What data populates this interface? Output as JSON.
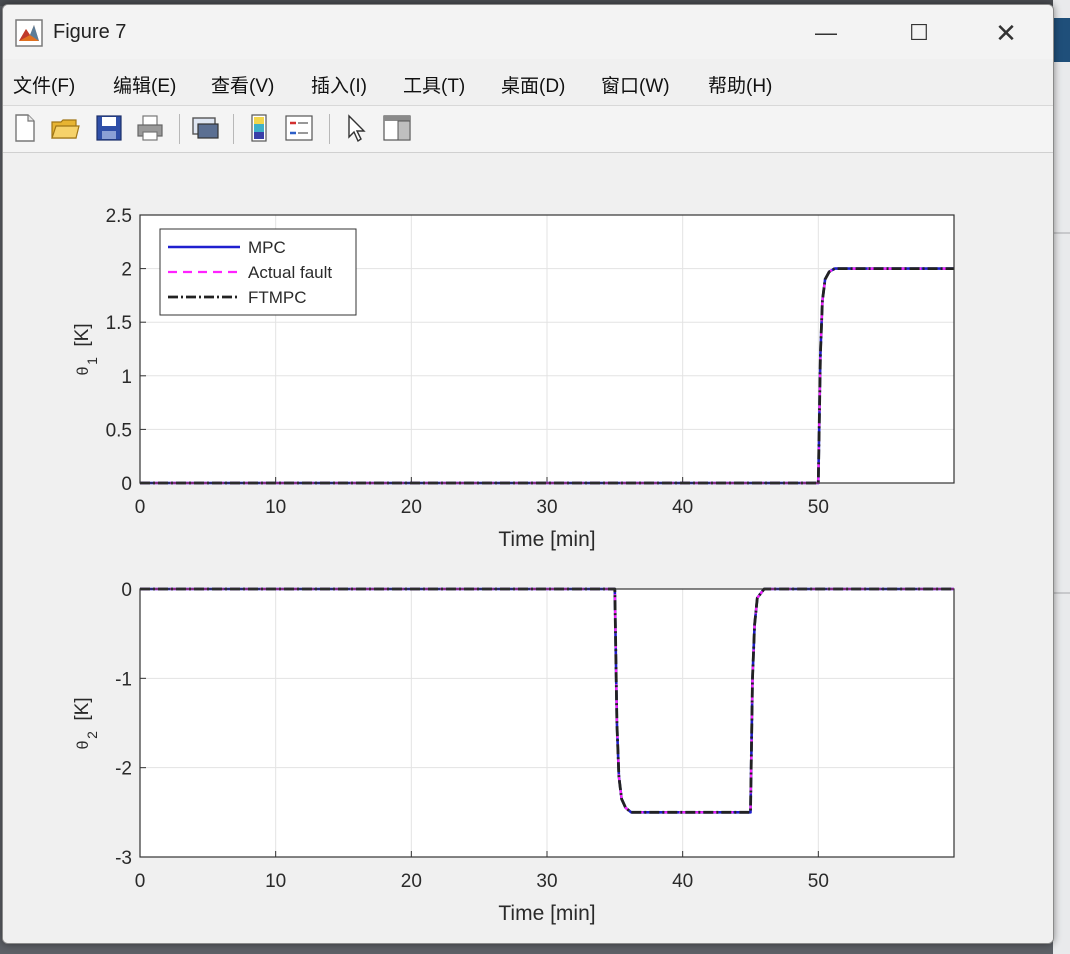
{
  "window": {
    "title": "Figure 7",
    "controls": {
      "minimize": "—",
      "maximize": "☐",
      "close": "✕"
    }
  },
  "menu": [
    "文件(F)",
    "编辑(E)",
    "查看(V)",
    "插入(I)",
    "工具(T)",
    "桌面(D)",
    "窗口(W)",
    "帮助(H)"
  ],
  "toolbar": {
    "buttons": [
      "new-figure-icon",
      "open-file-icon",
      "save-icon",
      "print-icon",
      "link-plot-icon",
      "insert-colorbar-icon",
      "insert-legend-icon",
      "edit-plot-pointer-icon",
      "property-inspector-icon"
    ]
  },
  "colors": {
    "mpc": "#1f1fcf",
    "actual_fault": "#ff22ff",
    "ftmpc": "#222222"
  },
  "chart_data": [
    {
      "type": "line",
      "ylabel": "θ1 [K]",
      "ylabel_main": "θ",
      "ylabel_sub": "1",
      "ylabel_unit": "[K]",
      "xlabel": "Time [min]",
      "xlim": [
        0,
        60
      ],
      "ylim": [
        0,
        2.5
      ],
      "xticks": [
        "0",
        "10",
        "20",
        "30",
        "40",
        "50"
      ],
      "yticks": [
        "0",
        "0.5",
        "1",
        "1.5",
        "2",
        "2.5"
      ],
      "grid": true,
      "legend_position": "top-left",
      "legend": [
        "MPC",
        "Actual fault",
        "FTMPC"
      ],
      "series": [
        {
          "name": "MPC",
          "x": [
            0,
            50,
            50.15,
            50.3,
            50.5,
            50.8,
            51.2,
            52,
            60
          ],
          "y": [
            0,
            0,
            1.2,
            1.7,
            1.9,
            1.97,
            2.0,
            2.0,
            2.0
          ]
        },
        {
          "name": "Actual fault",
          "x": [
            0,
            50,
            50.15,
            50.3,
            50.5,
            50.8,
            51.2,
            52,
            60
          ],
          "y": [
            0,
            0,
            1.2,
            1.7,
            1.9,
            1.97,
            2.0,
            2.0,
            2.0
          ]
        },
        {
          "name": "FTMPC",
          "x": [
            0,
            50,
            50.15,
            50.3,
            50.5,
            50.8,
            51.2,
            52,
            60
          ],
          "y": [
            0,
            0,
            1.2,
            1.7,
            1.9,
            1.97,
            2.0,
            2.0,
            2.0
          ]
        }
      ]
    },
    {
      "type": "line",
      "ylabel": "θ2 [K]",
      "ylabel_main": "θ",
      "ylabel_sub": "2",
      "ylabel_unit": "[K]",
      "xlabel": "Time [min]",
      "xlim": [
        0,
        60
      ],
      "ylim": [
        -3,
        0
      ],
      "xticks": [
        "0",
        "10",
        "20",
        "30",
        "40",
        "50"
      ],
      "yticks": [
        "0",
        "-1",
        "-2",
        "-3"
      ],
      "grid": true,
      "series": [
        {
          "name": "MPC",
          "x": [
            0,
            35,
            35.15,
            35.3,
            35.5,
            35.8,
            36.2,
            37,
            45,
            45.15,
            45.3,
            45.5,
            46,
            60
          ],
          "y": [
            0,
            0,
            -1.5,
            -2.1,
            -2.35,
            -2.45,
            -2.5,
            -2.5,
            -2.5,
            -1.0,
            -0.4,
            -0.1,
            0,
            0
          ]
        },
        {
          "name": "Actual fault",
          "x": [
            0,
            35,
            35.15,
            35.3,
            35.5,
            35.8,
            36.2,
            37,
            45,
            45.15,
            45.3,
            45.5,
            46,
            60
          ],
          "y": [
            0,
            0,
            -1.5,
            -2.1,
            -2.35,
            -2.45,
            -2.5,
            -2.5,
            -2.5,
            -1.0,
            -0.4,
            -0.1,
            0,
            0
          ]
        },
        {
          "name": "FTMPC",
          "x": [
            0,
            35,
            35.15,
            35.3,
            35.5,
            35.8,
            36.2,
            37,
            45,
            45.15,
            45.3,
            45.5,
            46,
            60
          ],
          "y": [
            0,
            0,
            -1.5,
            -2.1,
            -2.35,
            -2.45,
            -2.5,
            -2.5,
            -2.5,
            -1.0,
            -0.4,
            -0.1,
            0,
            0
          ]
        }
      ]
    }
  ]
}
